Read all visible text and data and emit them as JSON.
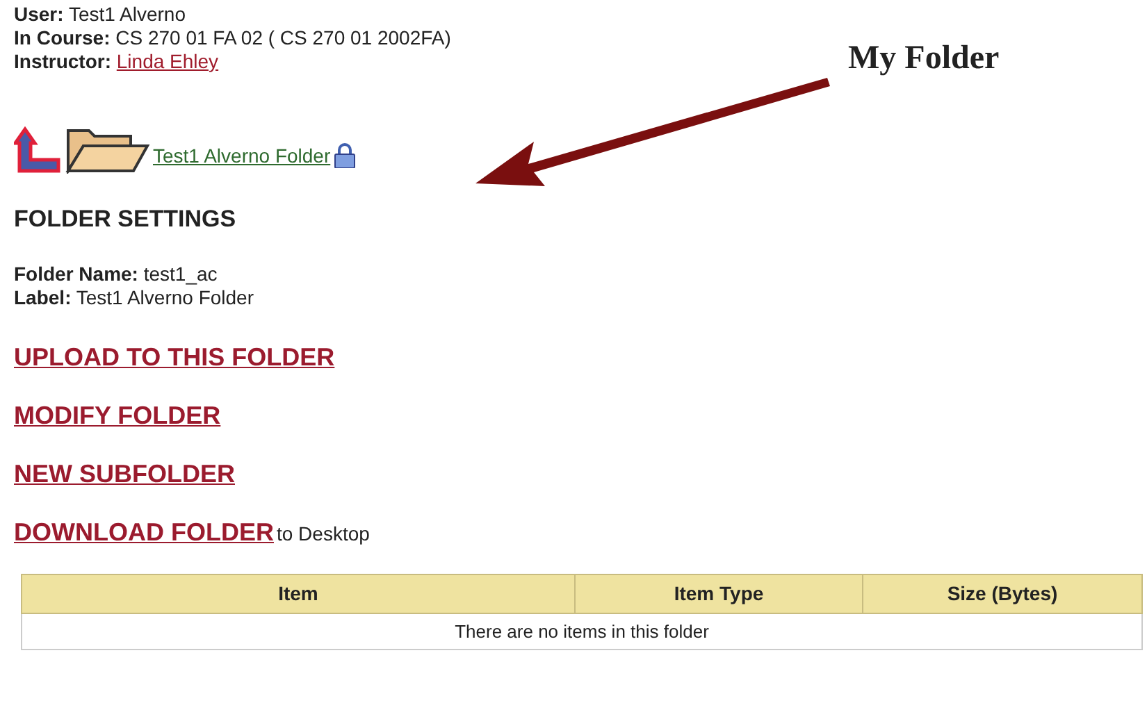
{
  "user_info": [
    {
      "label": "User:",
      "value": "Test1 Alverno"
    },
    {
      "label": "In Course:",
      "value": "CS 270 01 FA 02 ( CS 270 01 2002FA)"
    },
    {
      "label": "Instructor:",
      "value": "Linda Ehley",
      "kind": "link"
    }
  ],
  "folder_link": "Test1 Alverno Folder",
  "annotation": "My Folder",
  "section_title": "FOLDER SETTINGS",
  "settings": [
    {
      "label": "Folder Name:",
      "value": "test1_ac"
    },
    {
      "label": "Label:",
      "value": "Test1 Alverno Folder"
    }
  ],
  "actions": [
    {
      "label": "UPLOAD TO THIS FOLDER"
    },
    {
      "label": "MODIFY FOLDER"
    },
    {
      "label": "NEW SUBFOLDER"
    },
    {
      "label": "DOWNLOAD FOLDER",
      "suffix": "to Desktop"
    }
  ],
  "table": {
    "columns": [
      "Item",
      "Item Type",
      "Size (Bytes)"
    ],
    "empty_message": "There are no items in this folder"
  }
}
